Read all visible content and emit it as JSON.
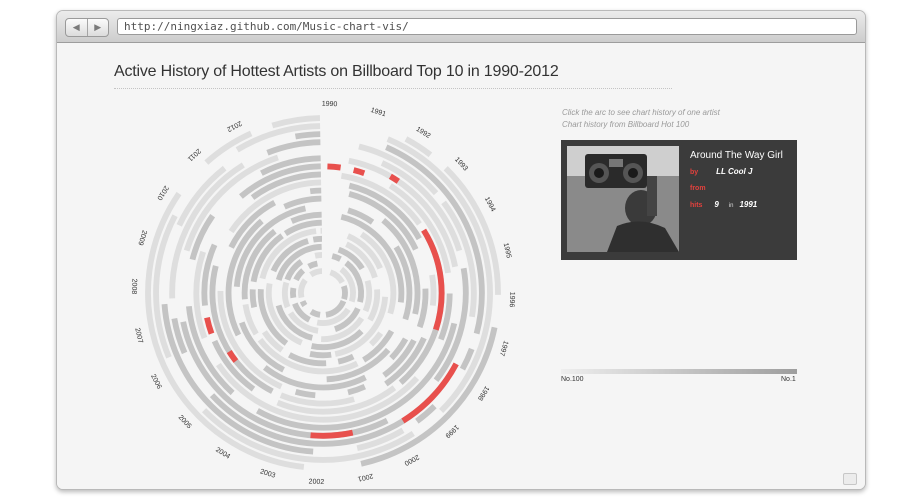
{
  "browser": {
    "back_icon": "back-arrow-icon",
    "forward_icon": "forward-arrow-icon",
    "url": "http://ningxiaz.github.com/Music-chart-vis/"
  },
  "page": {
    "title": "Active History of Hottest Artists on Billboard Top 10 in 1990-2012",
    "hint_line1": "Click the arc to see chart history of one artist",
    "hint_line2": "Chart history from Billboard Hot 100"
  },
  "chart_data": {
    "type": "radial-timeline",
    "years": [
      "1990",
      "1991",
      "1992",
      "1993",
      "1994",
      "1995",
      "1996",
      "1997",
      "1998",
      "1999",
      "2000",
      "2001",
      "2002",
      "2003",
      "2004",
      "2005",
      "2006",
      "2007",
      "2008",
      "2009",
      "2010",
      "2011",
      "2012"
    ],
    "ring_count": 20,
    "selected_artist": "LL Cool J",
    "colors": {
      "base": "#c4c4c4",
      "light": "#dedede",
      "highlight": "#e8504d"
    }
  },
  "card": {
    "song": "Around The Way Girl",
    "by_label": "by",
    "artist": "LL Cool J",
    "from_label": "from",
    "hits_label": "hits",
    "hits": "9",
    "in_label": "in",
    "year": "1991"
  },
  "scale": {
    "left_label": "No.100",
    "right_label": "No.1"
  }
}
